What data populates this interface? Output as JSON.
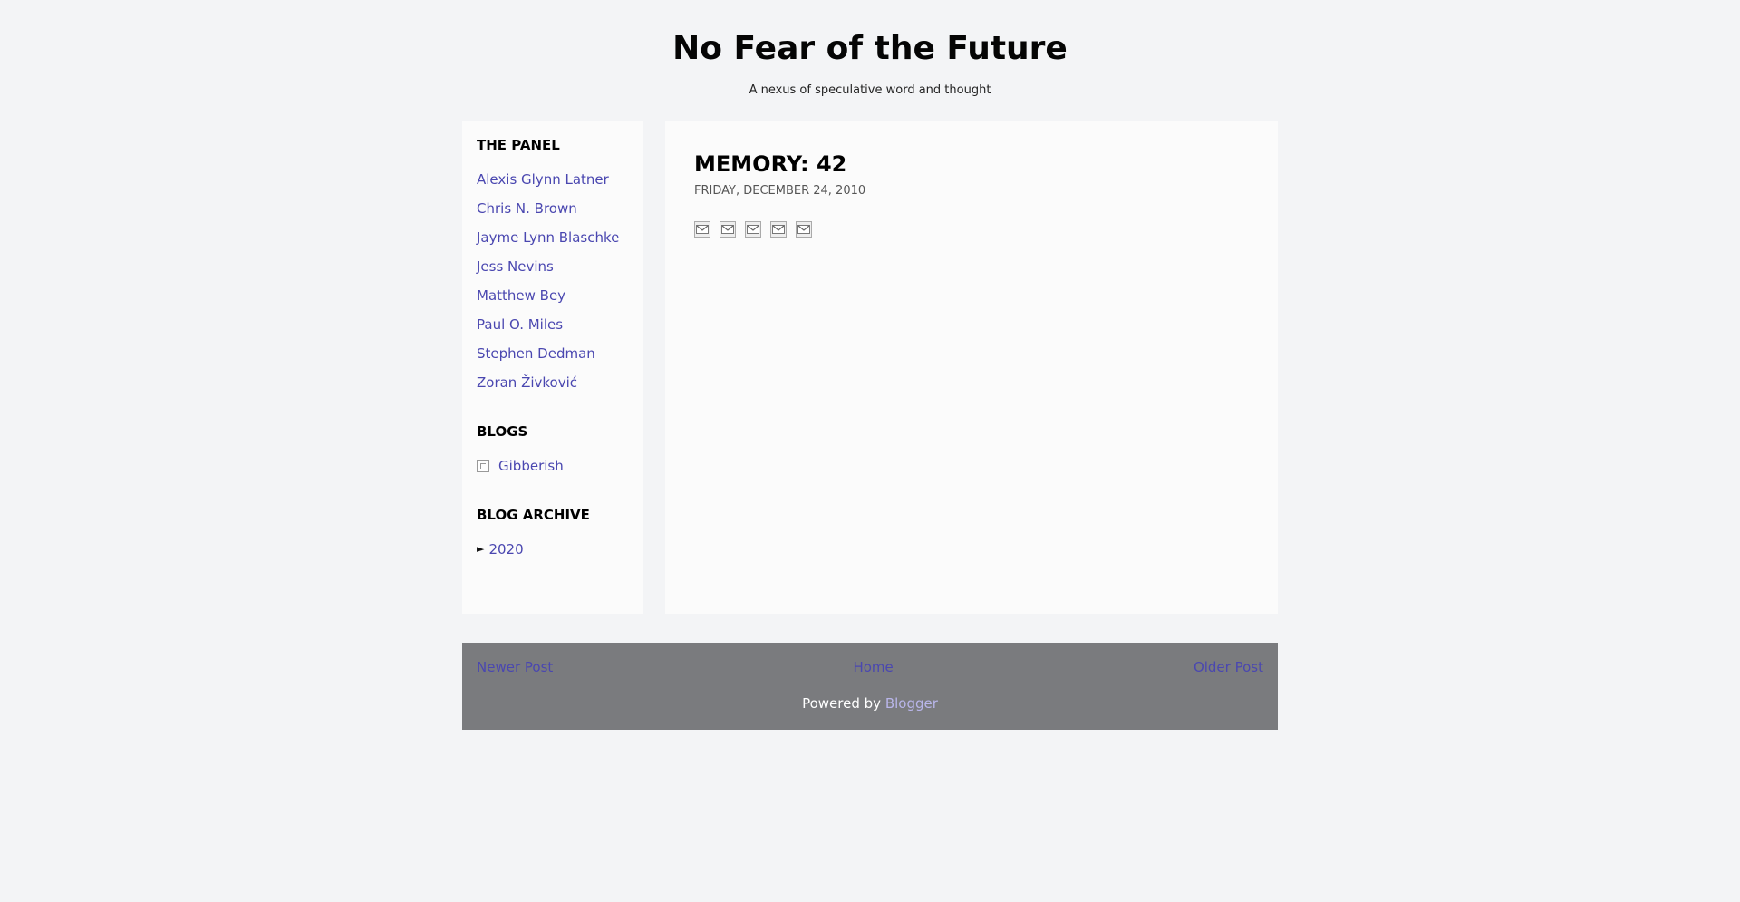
{
  "header": {
    "title": "No Fear of the Future",
    "description": "A nexus of speculative word and thought"
  },
  "sidebar": {
    "panel": {
      "heading": "The Panel",
      "items": [
        "Alexis Glynn Latner",
        "Chris N. Brown",
        "Jayme Lynn Blaschke",
        "Jess Nevins",
        "Matthew Bey",
        "Paul O. Miles",
        "Stephen Dedman",
        "Zoran Živković"
      ]
    },
    "blogs": {
      "heading": "Blogs",
      "items": [
        "Gibberish"
      ]
    },
    "archive": {
      "heading": "Blog Archive",
      "toggle": "►",
      "year": "2020"
    }
  },
  "post": {
    "title": "MEMORY: 42",
    "date": "Friday, December 24, 2010",
    "share_icons": [
      "email-icon",
      "blog-this-icon",
      "twitter-icon",
      "facebook-icon",
      "pinterest-icon"
    ]
  },
  "footer": {
    "newer": "Newer Post",
    "home": "Home",
    "older": "Older Post",
    "powered_prefix": "Powered by ",
    "powered_link": "Blogger"
  },
  "colors": {
    "link": "#4a47b0",
    "background": "#f3f4f6",
    "footer": "#7a7b7e"
  }
}
